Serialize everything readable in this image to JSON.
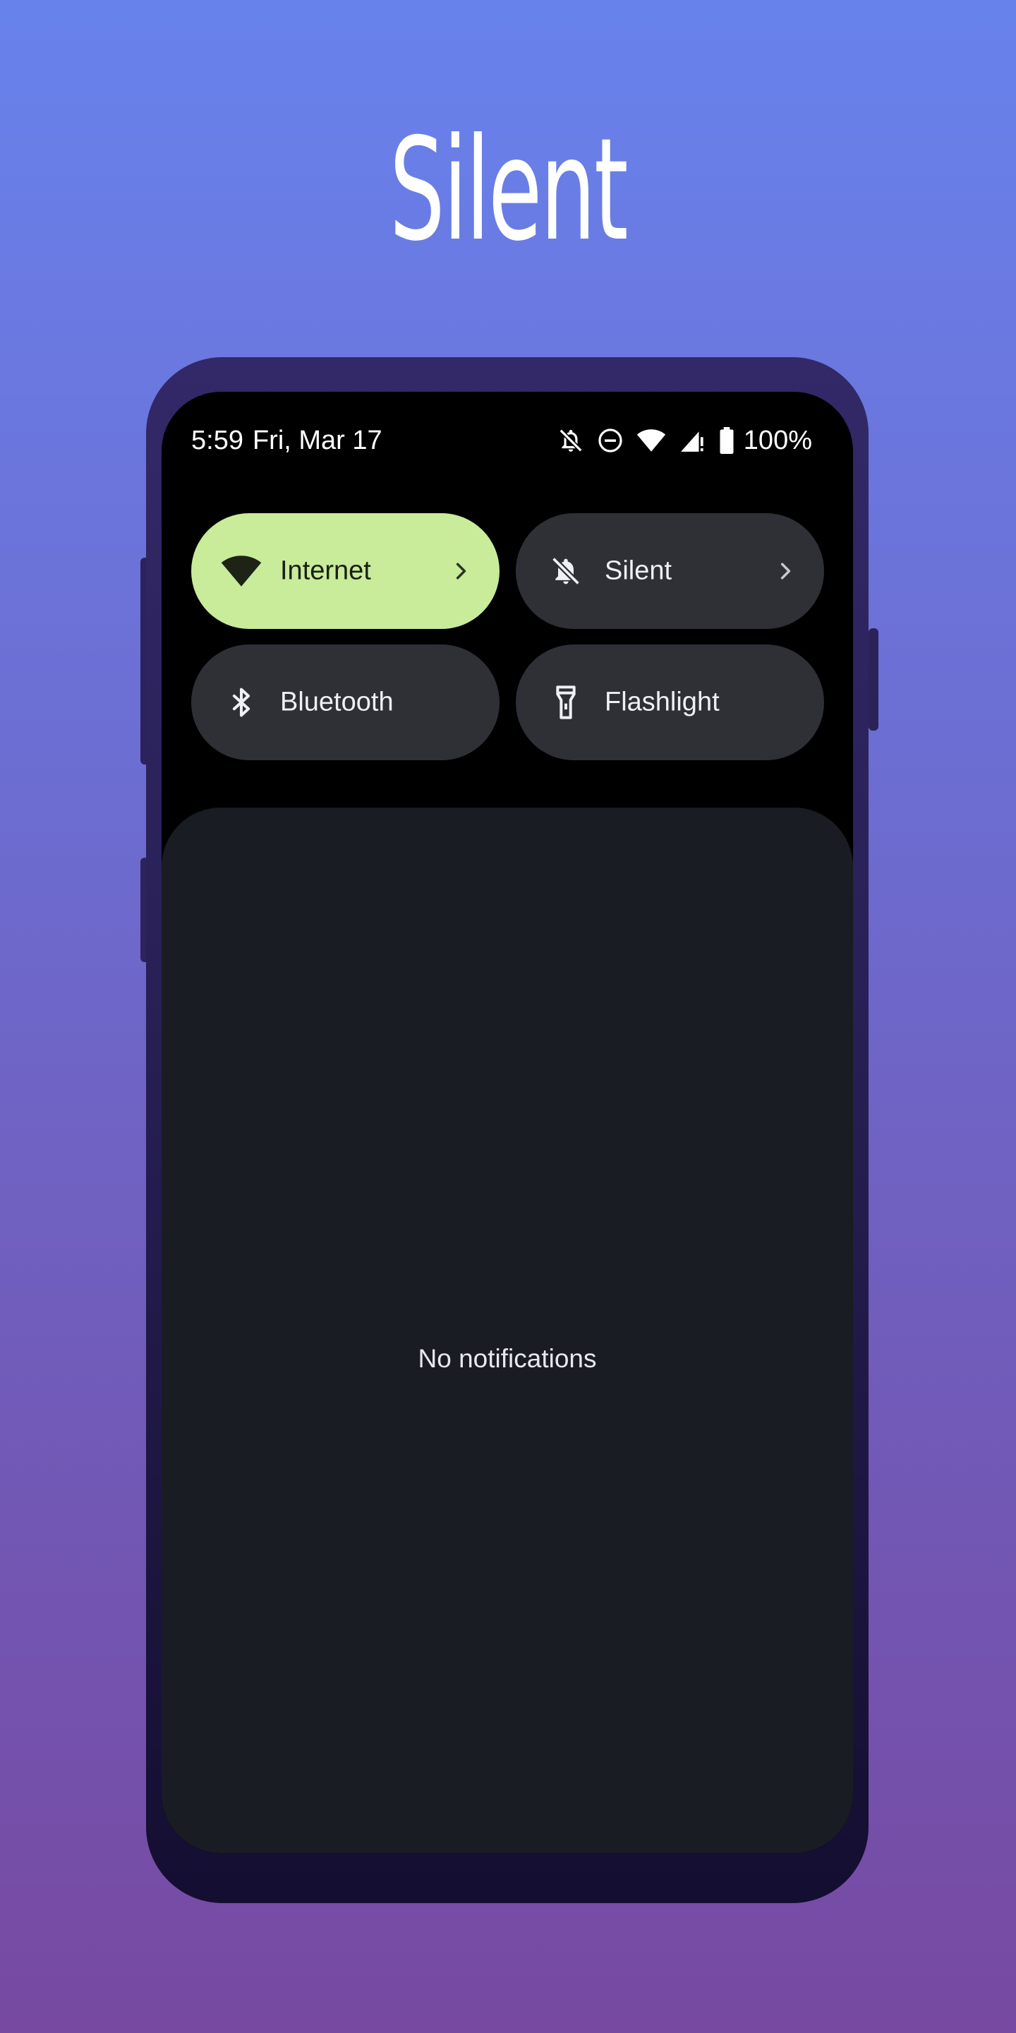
{
  "hero": {
    "title": "Silent"
  },
  "status_bar": {
    "time": "5:59",
    "date": "Fri, Mar 17",
    "battery_percent": "100%",
    "icons": [
      "bell-off-icon",
      "do-not-disturb-icon",
      "wifi-icon",
      "cell-signal-icon",
      "battery-icon"
    ]
  },
  "quick_settings": {
    "tiles": [
      {
        "label": "Internet",
        "icon": "wifi-icon",
        "active": true,
        "has_chevron": true
      },
      {
        "label": "Silent",
        "icon": "bell-off-icon",
        "active": false,
        "has_chevron": true
      },
      {
        "label": "Bluetooth",
        "icon": "bluetooth-icon",
        "active": false,
        "has_chevron": false
      },
      {
        "label": "Flashlight",
        "icon": "flashlight-icon",
        "active": false,
        "has_chevron": false
      }
    ]
  },
  "notifications": {
    "empty_text": "No notifications"
  },
  "colors": {
    "background_top": "#6882ec",
    "background_bottom": "#7749a1",
    "active_tile": "#c8ec9a",
    "inactive_tile": "#2e3036",
    "panel": "#1a1c23"
  }
}
